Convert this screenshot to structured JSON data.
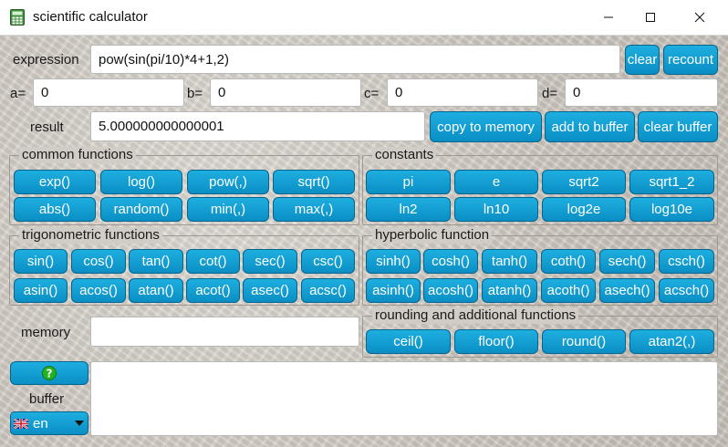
{
  "window": {
    "title": "scientific calculator",
    "minimize_icon": "minimize-icon",
    "maximize_icon": "maximize-icon",
    "close_icon": "close-icon"
  },
  "expression": {
    "label": "expression",
    "value": "pow(sin(pi/10)*4+1,2)",
    "clear_label": "clear",
    "recount_label": "recount"
  },
  "variables": [
    {
      "label": "a=",
      "value": "0"
    },
    {
      "label": "b=",
      "value": "0"
    },
    {
      "label": "c=",
      "value": "0"
    },
    {
      "label": "d=",
      "value": "0"
    }
  ],
  "result": {
    "label": "result",
    "value": "5.000000000000001",
    "copy_label": "copy to memory",
    "add_label": "add to buffer",
    "clear_label": "clear buffer"
  },
  "groups": {
    "common": {
      "title": "common functions",
      "buttons": [
        "exp()",
        "log()",
        "pow(,)",
        "sqrt()",
        "abs()",
        "random()",
        "min(,)",
        "max(,)"
      ]
    },
    "constants": {
      "title": "constants",
      "buttons": [
        "pi",
        "e",
        "sqrt2",
        "sqrt1_2",
        "ln2",
        "ln10",
        "log2e",
        "log10e"
      ]
    },
    "trig": {
      "title": "trigonometric functions",
      "buttons": [
        "sin()",
        "cos()",
        "tan()",
        "cot()",
        "sec()",
        "csc()",
        "asin()",
        "acos()",
        "atan()",
        "acot()",
        "asec()",
        "acsc()"
      ]
    },
    "hyperbolic": {
      "title": "hyperbolic function",
      "buttons": [
        "sinh()",
        "cosh()",
        "tanh()",
        "coth()",
        "sech()",
        "csch()",
        "asinh()",
        "acosh()",
        "atanh()",
        "acoth()",
        "asech()",
        "acsch()"
      ]
    },
    "rounding": {
      "title": "rounding and additional functions",
      "buttons": [
        "ceil()",
        "floor()",
        "round()",
        "atan2(,)"
      ]
    }
  },
  "memory": {
    "label": "memory",
    "value": ""
  },
  "buffer": {
    "label": "buffer",
    "value": "",
    "help_icon": "help-icon"
  },
  "language": {
    "value": "en",
    "flag_icon": "uk-flag-icon",
    "arrow_icon": "chevron-down-icon"
  },
  "colors": {
    "button": "#0a9fd6",
    "button_border": "#06658e",
    "help_icon": "#22b21f"
  }
}
